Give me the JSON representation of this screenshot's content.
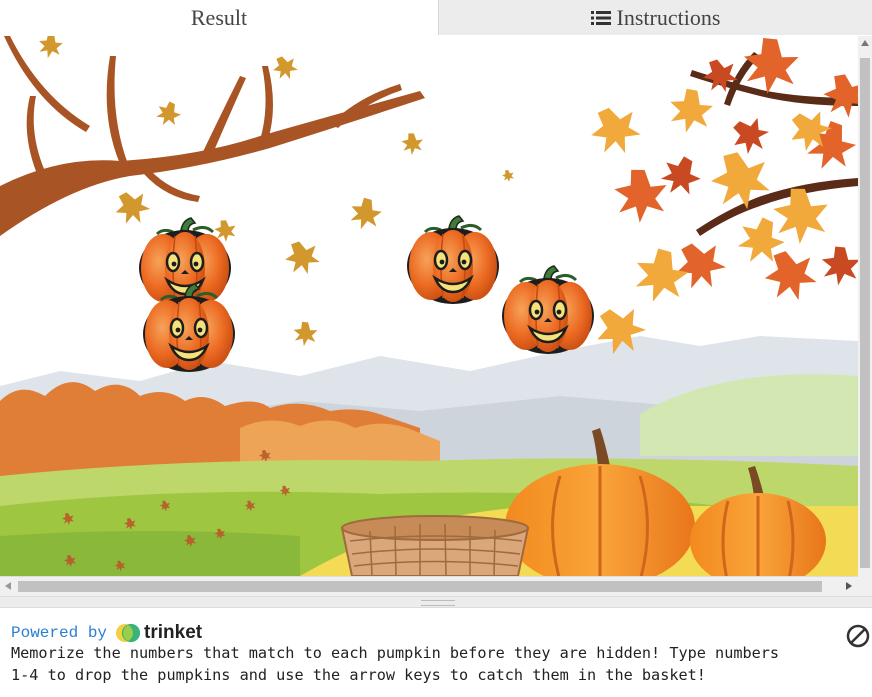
{
  "tabs": {
    "result_label": "Result",
    "instructions_label": "Instructions",
    "active": "Result"
  },
  "game": {
    "pumpkin_count": 4,
    "basket_count": 1
  },
  "console": {
    "powered_by": "Powered by",
    "brand": "trinket",
    "message": "Memorize the numbers that match to each pumpkin before they are hidden! Type numbers\n1-4 to drop the pumpkins and use the arrow keys to catch them in the basket!"
  },
  "colors": {
    "link_blue": "#2a7fd4",
    "pumpkin_orange": "#e8601c",
    "leaf_orange": "#e8892a",
    "grass_yellow": "#f2d64a"
  },
  "icons": {
    "instructions": "list-icon",
    "stop": "stop-icon",
    "brand": "trinket-logo-icon"
  }
}
